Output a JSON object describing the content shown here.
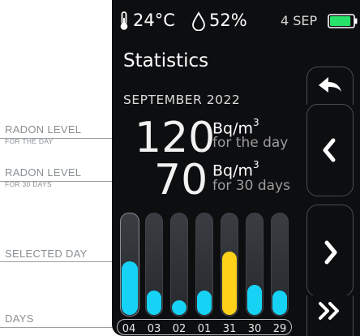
{
  "annotations": {
    "radon_day": {
      "big": "RADON LEVEL",
      "small": "FOR THE DAY"
    },
    "radon_30": {
      "big": "RADON LEVEL",
      "small": "FOR 30 DAYS"
    },
    "selected_day": {
      "big": "SELECTED DAY"
    },
    "days": {
      "big": "DAYS"
    }
  },
  "status": {
    "temperature": "24°C",
    "humidity": "52%",
    "date": "4 SEP",
    "battery_level": 0.9,
    "battery_color": "#27e36a"
  },
  "screen": {
    "title": "Statistics",
    "month": "SEPTEMBER  2022",
    "day_value": "120",
    "day_unit": "Bq/m",
    "day_unit_sup": "3",
    "day_label": "for the day",
    "month_value": "70",
    "month_unit": "Bq/m",
    "month_unit_sup": "3",
    "month_label": "for 30 days"
  },
  "nav": {
    "back_icon": "back-arrow-icon",
    "prev_icon": "chevron-left-icon",
    "next_icon": "chevron-right-icon",
    "skip_icon": "double-chevron-right-icon"
  },
  "colors": {
    "normal_bar": "#16d3f5",
    "selected_bar": "#ffd21a"
  },
  "bars": [
    {
      "day": "04",
      "level": 0.52,
      "selected": false
    },
    {
      "day": "03",
      "level": 0.24,
      "selected": false
    },
    {
      "day": "02",
      "level": 0.14,
      "selected": false
    },
    {
      "day": "01",
      "level": 0.24,
      "selected": false
    },
    {
      "day": "31",
      "level": 0.62,
      "selected": true
    },
    {
      "day": "30",
      "level": 0.29,
      "selected": false
    },
    {
      "day": "29",
      "level": 0.24,
      "selected": false
    }
  ]
}
